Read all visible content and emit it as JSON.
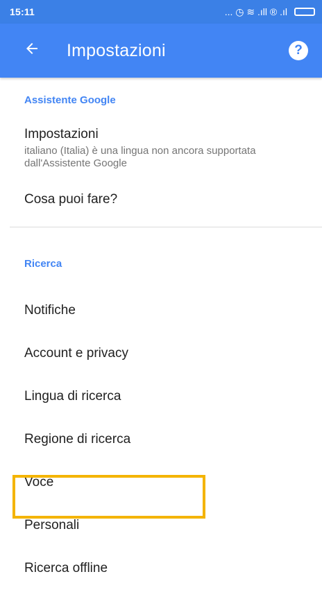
{
  "status_bar": {
    "time": "15:11",
    "icons_text": "... ◷ ≋ .ıll ® .ıl"
  },
  "app_bar": {
    "back_icon": "arrow-left-icon",
    "title": "Impostazioni",
    "help_icon": "help-circle-icon",
    "help_glyph": "?"
  },
  "sections": {
    "assistant": {
      "header": "Assistente Google",
      "settings_title": "Impostazioni",
      "settings_subtitle": "italiano (Italia) è una lingua non ancora supportata dall'Assistente Google",
      "what_can_you_do": "Cosa puoi fare?"
    },
    "search": {
      "header": "Ricerca",
      "items": [
        "Notifiche",
        "Account e privacy",
        "Lingua di ricerca",
        "Regione di ricerca",
        "Voce",
        "Personali",
        "Ricerca offline"
      ]
    }
  },
  "highlight_color": "#f4b400",
  "accent_color": "#4285f4"
}
